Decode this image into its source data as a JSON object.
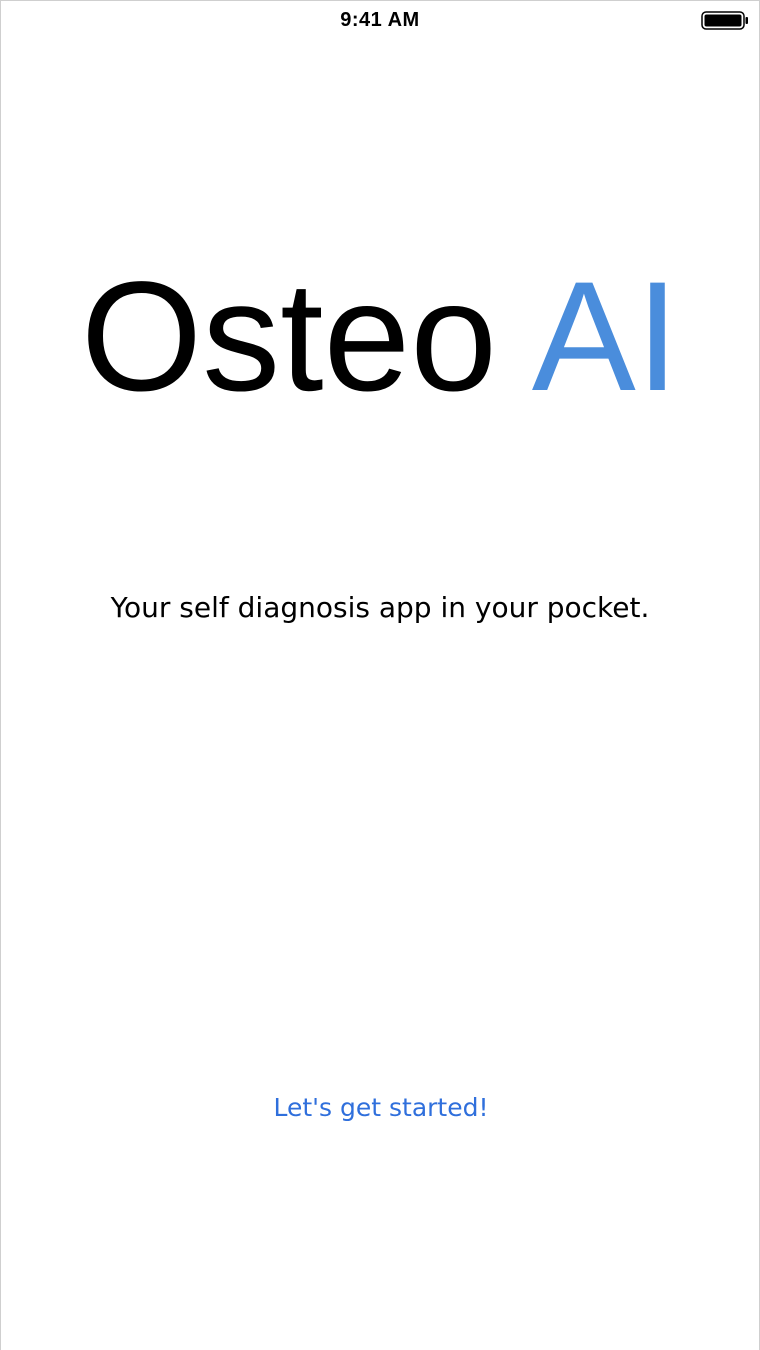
{
  "status_bar": {
    "time": "9:41 AM",
    "battery_icon": "battery-full-icon"
  },
  "logo": {
    "word_1": "Osteo",
    "word_2": "AI",
    "word_2_color": "#4a8ddc"
  },
  "tagline": "Your self diagnosis app in your pocket.",
  "cta": {
    "label": "Let's get started!",
    "color": "#2f6fdc"
  }
}
